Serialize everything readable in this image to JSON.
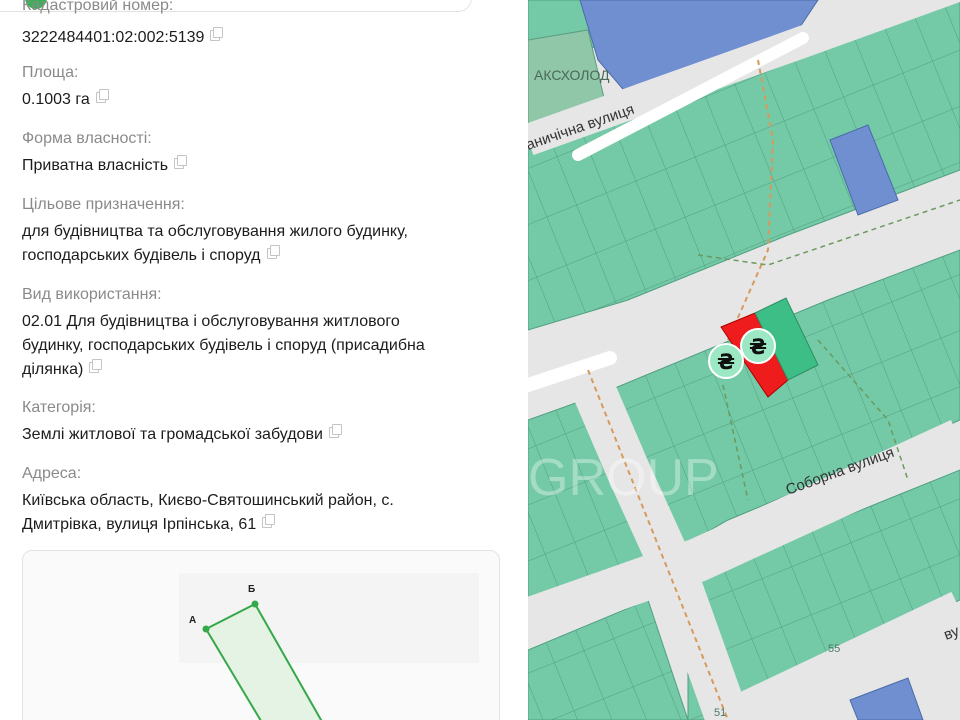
{
  "panel": {
    "fields": [
      {
        "label": "Кадастровий номер:",
        "value": "3222484401:02:002:5139"
      },
      {
        "label": "Площа:",
        "value": "0.1003 га"
      },
      {
        "label": "Форма власності:",
        "value": "Приватна власність"
      },
      {
        "label": "Цільове призначення:",
        "value_lines": [
          "для будівництва та обслуговування жилого будинку,",
          "господарських будівель і споруд"
        ]
      },
      {
        "label": "Вид використання:",
        "value_lines": [
          "02.01 Для будівництва і обслуговування житлового",
          "будинку, господарських будівель і споруд (присадибна",
          "ділянка)"
        ]
      },
      {
        "label": "Категорія:",
        "value": "Землі житлової та громадської забудови"
      },
      {
        "label": "Адреса:",
        "value_lines": [
          "Київська область, Києво-Святошинський район, с.",
          "Дмитрівка, вулиця Ірпінська, 61"
        ]
      }
    ],
    "scheme": {
      "point_a": "А",
      "point_b": "Б"
    }
  },
  "map": {
    "labels": {
      "street_top": "аничічна вулиця",
      "street_main": "Соборна вулиця",
      "street_bottom_right": "ву",
      "business": "АКСХОЛОД",
      "watermark": "GROUP",
      "house_55": "55",
      "house_51": "51"
    },
    "price_marker": "₴",
    "colors": {
      "parcel_green": "#74c9a6",
      "parcel_blue": "#6f8fd1",
      "selected_parcel": "#ee1c1c",
      "highlight_parcel": "#3dbe86",
      "road": "#e6e6e6",
      "boundary_dash": "#d69a5c"
    }
  }
}
